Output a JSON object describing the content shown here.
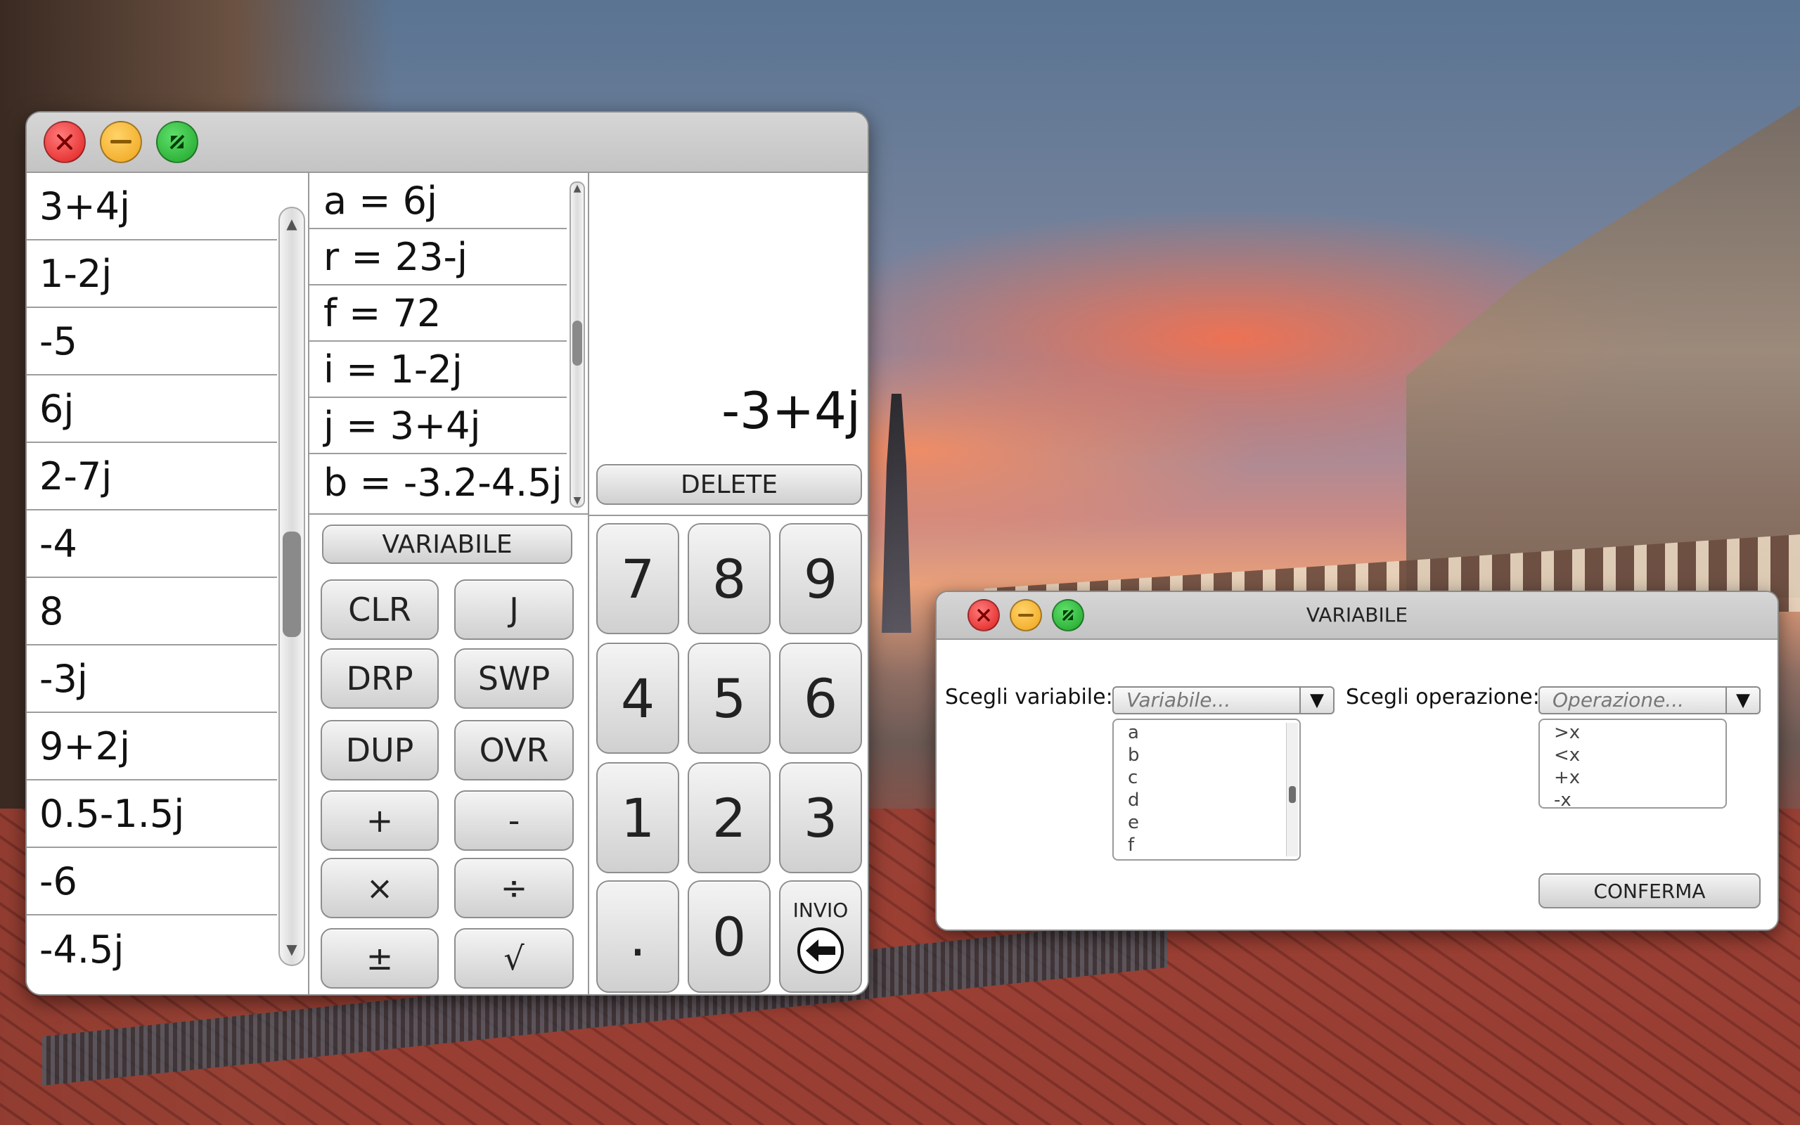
{
  "calculator": {
    "stack": [
      "3+4j",
      "1-2j",
      "-5",
      "6j",
      "2-7j",
      "-4",
      "8",
      "-3j",
      "9+2j",
      "0.5-1.5j",
      "-6",
      "-4.5j"
    ],
    "variables": [
      "a = 6j",
      "r = 23-j",
      "f = 72",
      "i = 1-2j",
      "j = 3+4j",
      "b = -3.2-4.5j"
    ],
    "display_value": "-3+4j",
    "delete_label": "DELETE",
    "variabile_label": "VARIABILE",
    "ops": {
      "clr": "CLR",
      "j": "J",
      "drp": "DRP",
      "swp": "SWP",
      "dup": "DUP",
      "ovr": "OVR",
      "plus": "+",
      "minus": "-",
      "times": "×",
      "divide": "÷",
      "plusminus": "±",
      "sqrt": "√"
    },
    "keys": [
      "7",
      "8",
      "9",
      "4",
      "5",
      "6",
      "1",
      "2",
      "3",
      ".",
      "0"
    ],
    "enter_label": "INVIO"
  },
  "dialog": {
    "title": "VARIABILE",
    "variable_label": "Scegli variabile:",
    "variable_placeholder": "Variabile...",
    "variable_options": [
      "a",
      "b",
      "c",
      "d",
      "e",
      "f"
    ],
    "operation_label": "Scegli operazione:",
    "operation_placeholder": "Operazione...",
    "operation_options": [
      ">x",
      "<x",
      "+x",
      "-x"
    ],
    "confirm_label": "CONFERMA"
  }
}
